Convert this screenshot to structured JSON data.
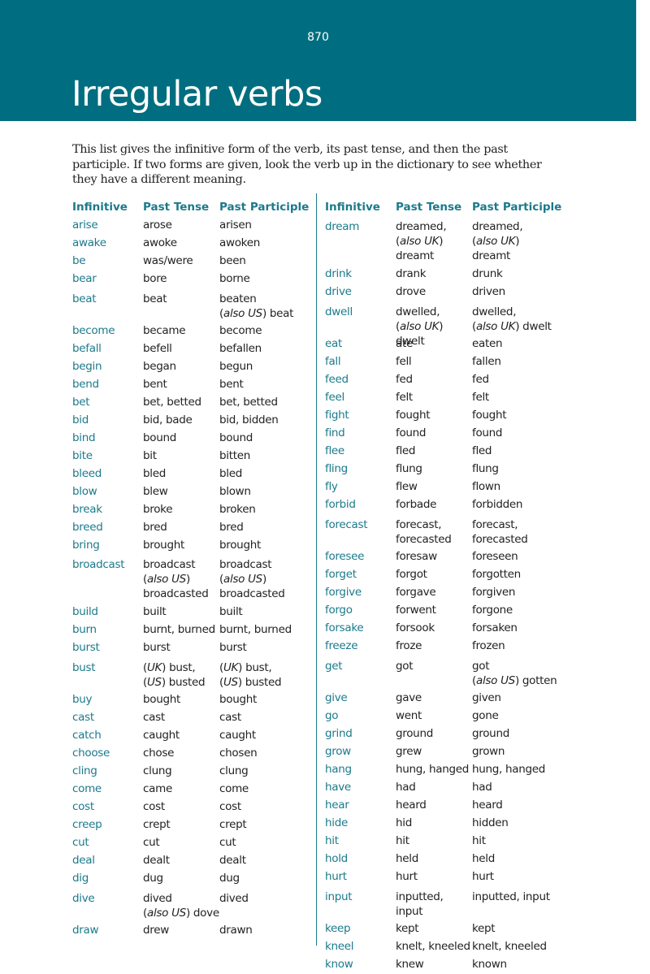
{
  "header": {
    "page_number": "870",
    "title": "Irregular verbs"
  },
  "intro": "This list gives the infinitive form of the verb, its past tense, and then the past participle. If two forms are given, look the verb up in the dictionary to see whether they have a different meaning.",
  "columns": {
    "infinitive": "Infinitive",
    "past_tense": "Past Tense",
    "past_participle": "Past Participle"
  },
  "colors": {
    "banner": "#006e80",
    "accent": "#1b7a8b",
    "text": "#222222"
  },
  "left_verbs": [
    {
      "inf": "arise",
      "past": "arose",
      "part": "arisen"
    },
    {
      "inf": "awake",
      "past": "awoke",
      "part": "awoken"
    },
    {
      "inf": "be",
      "past": "was/were",
      "part": "been"
    },
    {
      "inf": "bear",
      "past": "bore",
      "part": "borne"
    },
    {
      "inf": "beat",
      "past": "beat",
      "part": "beaten\n(also US) beat"
    },
    {
      "inf": "become",
      "past": "became",
      "part": "become"
    },
    {
      "inf": "befall",
      "past": "befell",
      "part": "befallen"
    },
    {
      "inf": "begin",
      "past": "began",
      "part": "begun"
    },
    {
      "inf": "bend",
      "past": "bent",
      "part": "bent"
    },
    {
      "inf": "bet",
      "past": "bet, betted",
      "part": "bet, betted"
    },
    {
      "inf": "bid",
      "past": "bid, bade",
      "part": "bid, bidden"
    },
    {
      "inf": "bind",
      "past": "bound",
      "part": "bound"
    },
    {
      "inf": "bite",
      "past": "bit",
      "part": "bitten"
    },
    {
      "inf": "bleed",
      "past": "bled",
      "part": "bled"
    },
    {
      "inf": "blow",
      "past": "blew",
      "part": "blown"
    },
    {
      "inf": "break",
      "past": "broke",
      "part": "broken"
    },
    {
      "inf": "breed",
      "past": "bred",
      "part": "bred"
    },
    {
      "inf": "bring",
      "past": "brought",
      "part": "brought"
    },
    {
      "inf": "broadcast",
      "past": "broadcast\n(also US)\nbroadcasted",
      "part": "broadcast\n(also US)\nbroadcasted"
    },
    {
      "inf": "build",
      "past": "built",
      "part": "built"
    },
    {
      "inf": "burn",
      "past": "burnt, burned",
      "part": "burnt, burned"
    },
    {
      "inf": "burst",
      "past": "burst",
      "part": "burst"
    },
    {
      "inf": "bust",
      "past": "(UK) bust,\n(US) busted",
      "part": "(UK) bust,\n(US) busted"
    },
    {
      "inf": "buy",
      "past": "bought",
      "part": "bought"
    },
    {
      "inf": "cast",
      "past": "cast",
      "part": "cast"
    },
    {
      "inf": "catch",
      "past": "caught",
      "part": "caught"
    },
    {
      "inf": "choose",
      "past": "chose",
      "part": "chosen"
    },
    {
      "inf": "cling",
      "past": "clung",
      "part": "clung"
    },
    {
      "inf": "come",
      "past": "came",
      "part": "come"
    },
    {
      "inf": "cost",
      "past": "cost",
      "part": "cost"
    },
    {
      "inf": "creep",
      "past": "crept",
      "part": "crept"
    },
    {
      "inf": "cut",
      "past": "cut",
      "part": "cut"
    },
    {
      "inf": "deal",
      "past": "dealt",
      "part": "dealt"
    },
    {
      "inf": "dig",
      "past": "dug",
      "part": "dug"
    },
    {
      "inf": "dive",
      "past": "dived\n(also US) dove",
      "part": "dived"
    },
    {
      "inf": "draw",
      "past": "drew",
      "part": "drawn"
    }
  ],
  "right_verbs": [
    {
      "inf": "dream",
      "past": "dreamed,\n(also UK)\ndreamt",
      "part": "dreamed,\n(also UK)\ndreamt"
    },
    {
      "inf": "drink",
      "past": "drank",
      "part": "drunk"
    },
    {
      "inf": "drive",
      "past": "drove",
      "part": "driven"
    },
    {
      "inf": "dwell",
      "past": "dwelled,\n(also UK) dwelt",
      "part": "dwelled,\n(also UK) dwelt"
    },
    {
      "inf": "eat",
      "past": "ate",
      "part": "eaten"
    },
    {
      "inf": "fall",
      "past": "fell",
      "part": "fallen"
    },
    {
      "inf": "feed",
      "past": "fed",
      "part": "fed"
    },
    {
      "inf": "feel",
      "past": "felt",
      "part": "felt"
    },
    {
      "inf": "fight",
      "past": "fought",
      "part": "fought"
    },
    {
      "inf": "find",
      "past": "found",
      "part": "found"
    },
    {
      "inf": "flee",
      "past": "fled",
      "part": "fled"
    },
    {
      "inf": "fling",
      "past": "flung",
      "part": "flung"
    },
    {
      "inf": "fly",
      "past": "flew",
      "part": "flown"
    },
    {
      "inf": "forbid",
      "past": "forbade",
      "part": "forbidden"
    },
    {
      "inf": "forecast",
      "past": "forecast,\nforecasted",
      "part": "forecast,\nforecasted"
    },
    {
      "inf": "foresee",
      "past": "foresaw",
      "part": "foreseen"
    },
    {
      "inf": "forget",
      "past": "forgot",
      "part": "forgotten"
    },
    {
      "inf": "forgive",
      "past": "forgave",
      "part": "forgiven"
    },
    {
      "inf": "forgo",
      "past": "forwent",
      "part": "forgone"
    },
    {
      "inf": "forsake",
      "past": "forsook",
      "part": "forsaken"
    },
    {
      "inf": "freeze",
      "past": "froze",
      "part": "frozen"
    },
    {
      "inf": "get",
      "past": "got",
      "part": "got\n(also US) gotten"
    },
    {
      "inf": "give",
      "past": "gave",
      "part": "given"
    },
    {
      "inf": "go",
      "past": "went",
      "part": "gone"
    },
    {
      "inf": "grind",
      "past": "ground",
      "part": "ground"
    },
    {
      "inf": "grow",
      "past": "grew",
      "part": "grown"
    },
    {
      "inf": "hang",
      "past": "hung, hanged",
      "part": "hung, hanged"
    },
    {
      "inf": "have",
      "past": "had",
      "part": "had"
    },
    {
      "inf": "hear",
      "past": "heard",
      "part": "heard"
    },
    {
      "inf": "hide",
      "past": "hid",
      "part": "hidden"
    },
    {
      "inf": "hit",
      "past": "hit",
      "part": "hit"
    },
    {
      "inf": "hold",
      "past": "held",
      "part": "held"
    },
    {
      "inf": "hurt",
      "past": "hurt",
      "part": "hurt"
    },
    {
      "inf": "input",
      "past": "inputted,\ninput",
      "part": "inputted, input"
    },
    {
      "inf": "keep",
      "past": "kept",
      "part": "kept"
    },
    {
      "inf": "kneel",
      "past": "knelt, kneeled",
      "part": "knelt, kneeled"
    },
    {
      "inf": "know",
      "past": "knew",
      "part": "known"
    }
  ]
}
